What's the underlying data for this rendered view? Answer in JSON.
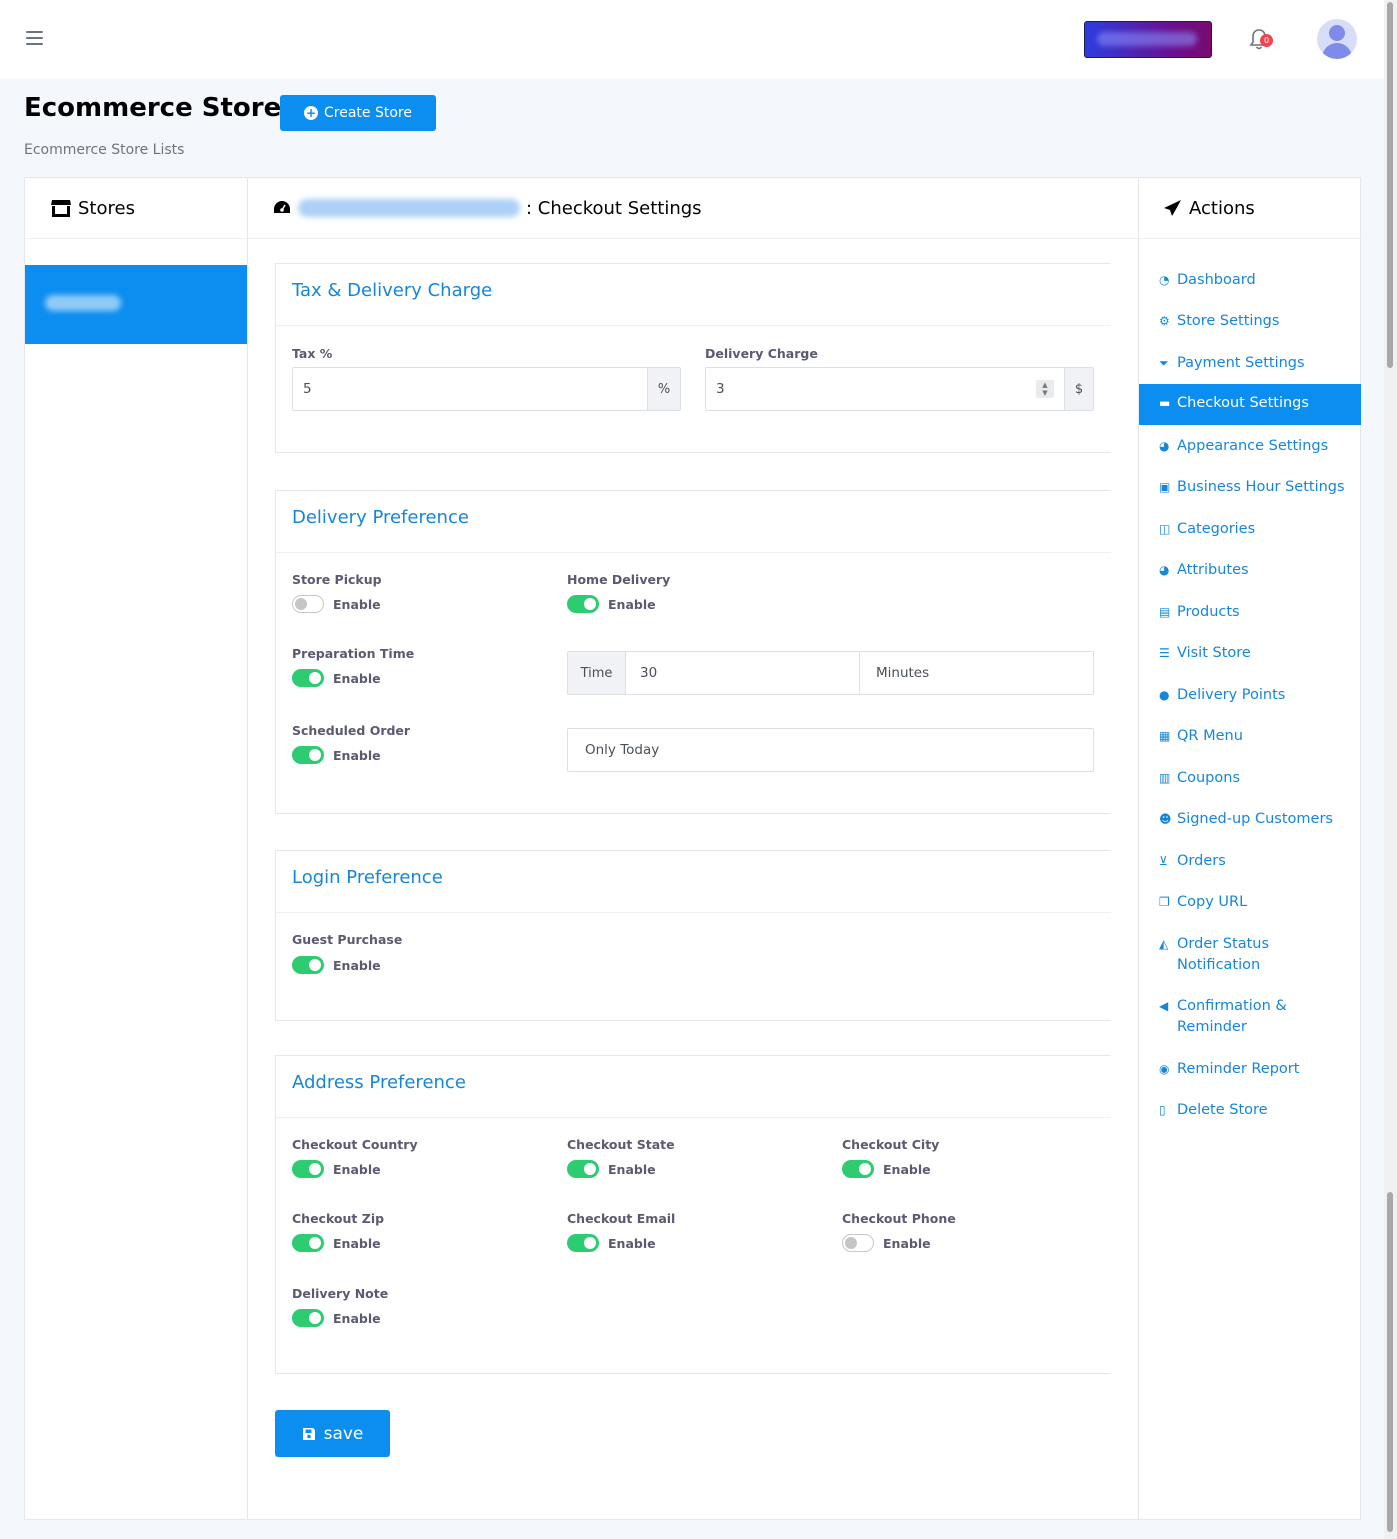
{
  "header": {
    "menu_icon": "hamburger-icon",
    "notification_count": "0"
  },
  "page": {
    "title": "Ecommerce Store",
    "create_button": "Create Store",
    "subtitle": "Ecommerce Store Lists"
  },
  "stores_panel": {
    "title": "Stores"
  },
  "settings_panel": {
    "title_suffix": ": Checkout Settings"
  },
  "actions_panel": {
    "title": "Actions"
  },
  "tax_section": {
    "title": "Tax & Delivery Charge",
    "tax_label": "Tax %",
    "tax_value": "5",
    "tax_addon": "%",
    "delivery_label": "Delivery Charge",
    "delivery_value": "3",
    "delivery_addon": "$"
  },
  "delivery_section": {
    "title": "Delivery Preference",
    "store_pickup": {
      "label": "Store Pickup",
      "toggle_text": "Enable",
      "enabled": false
    },
    "home_delivery": {
      "label": "Home Delivery",
      "toggle_text": "Enable",
      "enabled": true
    },
    "preparation_time": {
      "label": "Preparation Time",
      "toggle_text": "Enable",
      "enabled": true,
      "prefix": "Time",
      "value": "30",
      "unit": "Minutes"
    },
    "scheduled_order": {
      "label": "Scheduled Order",
      "toggle_text": "Enable",
      "enabled": true,
      "select_value": "Only Today"
    }
  },
  "login_section": {
    "title": "Login Preference",
    "guest_purchase": {
      "label": "Guest Purchase",
      "toggle_text": "Enable",
      "enabled": true
    }
  },
  "address_section": {
    "title": "Address Preference",
    "checkout_country": {
      "label": "Checkout Country",
      "toggle_text": "Enable",
      "enabled": true
    },
    "checkout_state": {
      "label": "Checkout State",
      "toggle_text": "Enable",
      "enabled": true
    },
    "checkout_city": {
      "label": "Checkout City",
      "toggle_text": "Enable",
      "enabled": true
    },
    "checkout_zip": {
      "label": "Checkout Zip",
      "toggle_text": "Enable",
      "enabled": true
    },
    "checkout_email": {
      "label": "Checkout Email",
      "toggle_text": "Enable",
      "enabled": true
    },
    "checkout_phone": {
      "label": "Checkout Phone",
      "toggle_text": "Enable",
      "enabled": false
    },
    "delivery_note": {
      "label": "Delivery Note",
      "toggle_text": "Enable",
      "enabled": true
    }
  },
  "save_button": "save",
  "actions": [
    {
      "label": "Dashboard",
      "icon": "dashboard-icon"
    },
    {
      "label": "Store Settings",
      "icon": "gear-icon"
    },
    {
      "label": "Payment Settings",
      "icon": "funnel-dollar-icon"
    },
    {
      "label": "Checkout Settings",
      "icon": "credit-card-icon",
      "active": true
    },
    {
      "label": "Appearance Settings",
      "icon": "palette-icon"
    },
    {
      "label": "Business Hour Settings",
      "icon": "calendar-check-icon"
    },
    {
      "label": "Categories",
      "icon": "columns-icon"
    },
    {
      "label": "Attributes",
      "icon": "palette-icon"
    },
    {
      "label": "Products",
      "icon": "boxes-icon"
    },
    {
      "label": "Visit Store",
      "icon": "list-alt-icon"
    },
    {
      "label": "Delivery Points",
      "icon": "map-marker-icon"
    },
    {
      "label": "QR Menu",
      "icon": "qrcode-icon"
    },
    {
      "label": "Coupons",
      "icon": "coupon-icon"
    },
    {
      "label": "Signed-up Customers",
      "icon": "users-icon"
    },
    {
      "label": "Orders",
      "icon": "cart-icon"
    },
    {
      "label": "Copy URL",
      "icon": "copy-icon"
    },
    {
      "label": "Order Status Notification",
      "icon": "bell-icon"
    },
    {
      "label": "Confirmation & Reminder",
      "icon": "bullhorn-icon"
    },
    {
      "label": "Reminder Report",
      "icon": "eye-icon"
    },
    {
      "label": "Delete Store",
      "icon": "trash-icon"
    }
  ]
}
